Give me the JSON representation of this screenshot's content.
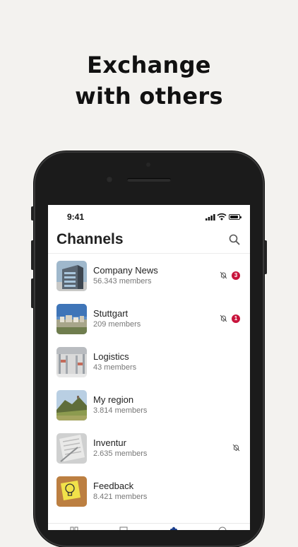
{
  "headline": {
    "line1": "Exchange",
    "line2": "with others"
  },
  "status_bar": {
    "time": "9:41"
  },
  "app": {
    "title": "Channels"
  },
  "channels": [
    {
      "name": "Company News",
      "members": "56.343 members",
      "muted": true,
      "unread": "3",
      "thumb_icon": "office-building"
    },
    {
      "name": "Stuttgart",
      "members": "209 members",
      "muted": true,
      "unread": "1",
      "thumb_icon": "city-skyline"
    },
    {
      "name": "Logistics",
      "members": "43 members",
      "muted": false,
      "unread": "",
      "thumb_icon": "warehouse"
    },
    {
      "name": "My region",
      "members": "3.814 members",
      "muted": false,
      "unread": "",
      "thumb_icon": "landscape"
    },
    {
      "name": "Inventur",
      "members": "2.635 members",
      "muted": true,
      "unread": "",
      "thumb_icon": "documents"
    },
    {
      "name": "Feedback",
      "members": "8.421 members",
      "muted": false,
      "unread": "",
      "thumb_icon": "lightbulb-note"
    }
  ],
  "colors": {
    "badge": "#c8143c",
    "background": "#f3f2ef",
    "active_tab": "#1a3e8c"
  }
}
